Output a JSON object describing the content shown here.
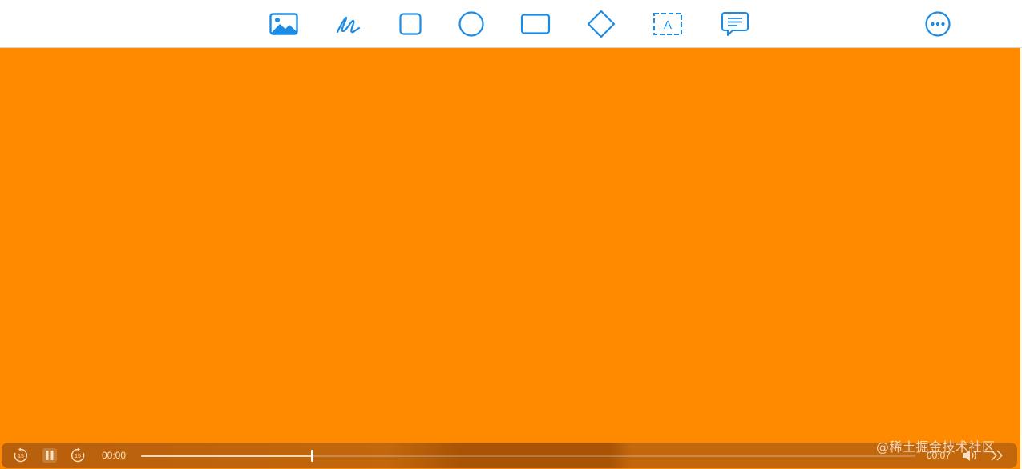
{
  "colors": {
    "accent": "#1a8ce6",
    "canvas": "#ff8a00",
    "toolbar_bg": "#ffffff"
  },
  "toolbar": {
    "tools": [
      {
        "name": "media-tool",
        "icon": "image-icon"
      },
      {
        "name": "draw-tool",
        "icon": "pen-scribble-icon"
      },
      {
        "name": "rounded-square-tool",
        "icon": "rounded-square-icon"
      },
      {
        "name": "circle-tool",
        "icon": "circle-icon"
      },
      {
        "name": "rectangle-tool",
        "icon": "rectangle-icon"
      },
      {
        "name": "diamond-tool",
        "icon": "diamond-icon"
      },
      {
        "name": "text-box-tool",
        "icon": "text-box-icon",
        "glyph": "A"
      },
      {
        "name": "comment-tool",
        "icon": "speech-bubble-icon"
      }
    ],
    "more_icon": "ellipsis-circle-icon"
  },
  "player": {
    "skip_back_label": "15",
    "skip_forward_label": "15",
    "play_state": "playing",
    "current_time": "00:00",
    "remaining_time": "00:07",
    "progress": 0.22,
    "icons": [
      "skip-back-15-icon",
      "pause-icon",
      "skip-forward-15-icon",
      "volume-icon",
      "fast-forward-icon"
    ]
  },
  "watermark": "@稀土掘金技术社区"
}
